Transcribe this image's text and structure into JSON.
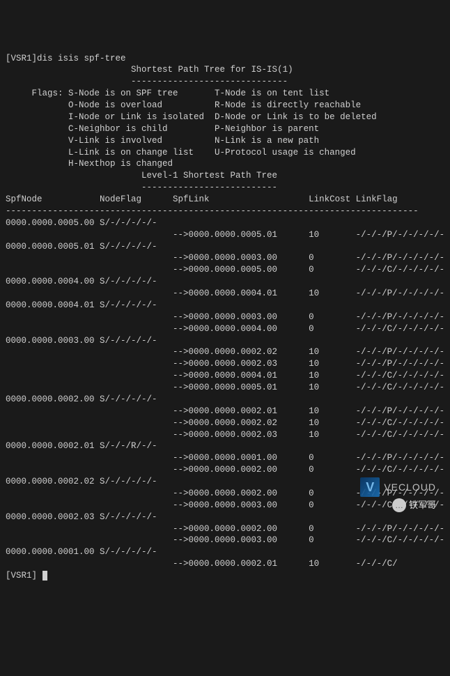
{
  "prompt1": "[VSR1]dis isis spf-tree",
  "title": "Shortest Path Tree for IS-IS(1)",
  "title_sep": "------------------------------",
  "flags_label": "Flags:",
  "flags": [
    {
      "l": "S-Node is on SPF tree",
      "r": "T-Node is on tent list"
    },
    {
      "l": "O-Node is overload",
      "r": "R-Node is directly reachable"
    },
    {
      "l": "I-Node or Link is isolated",
      "r": "D-Node or Link is to be deleted"
    },
    {
      "l": "C-Neighbor is child",
      "r": "P-Neighbor is parent"
    },
    {
      "l": "V-Link is involved",
      "r": "N-Link is a new path"
    },
    {
      "l": "L-Link is on change list",
      "r": "U-Protocol usage is changed"
    },
    {
      "l": "H-Nexthop is changed",
      "r": ""
    }
  ],
  "section_title": "Level-1 Shortest Path Tree",
  "section_sep": "--------------------------",
  "cols": {
    "c1": "SpfNode",
    "c2": "NodeFlag",
    "c3": "SpfLink",
    "c4": "LinkCost",
    "c5": "LinkFlag"
  },
  "hr": "-------------------------------------------------------------------------------",
  "rows": [
    {
      "node": "0000.0000.0005.00",
      "flag": "S/-/-/-/-/-",
      "links": [
        {
          "to": "-->0000.0000.0005.01",
          "cost": "10",
          "lf": "-/-/-/P/-/-/-/-/-"
        }
      ]
    },
    {
      "node": "0000.0000.0005.01",
      "flag": "S/-/-/-/-/-",
      "links": [
        {
          "to": "-->0000.0000.0003.00",
          "cost": "0",
          "lf": "-/-/-/P/-/-/-/-/-"
        },
        {
          "to": "-->0000.0000.0005.00",
          "cost": "0",
          "lf": "-/-/-/C/-/-/-/-/-"
        }
      ]
    },
    {
      "node": "0000.0000.0004.00",
      "flag": "S/-/-/-/-/-",
      "links": [
        {
          "to": "-->0000.0000.0004.01",
          "cost": "10",
          "lf": "-/-/-/P/-/-/-/-/-"
        }
      ]
    },
    {
      "node": "0000.0000.0004.01",
      "flag": "S/-/-/-/-/-",
      "links": [
        {
          "to": "-->0000.0000.0003.00",
          "cost": "0",
          "lf": "-/-/-/P/-/-/-/-/-"
        },
        {
          "to": "-->0000.0000.0004.00",
          "cost": "0",
          "lf": "-/-/-/C/-/-/-/-/-"
        }
      ]
    },
    {
      "node": "0000.0000.0003.00",
      "flag": "S/-/-/-/-/-",
      "links": [
        {
          "to": "-->0000.0000.0002.02",
          "cost": "10",
          "lf": "-/-/-/P/-/-/-/-/-"
        },
        {
          "to": "-->0000.0000.0002.03",
          "cost": "10",
          "lf": "-/-/-/P/-/-/-/-/-"
        },
        {
          "to": "-->0000.0000.0004.01",
          "cost": "10",
          "lf": "-/-/-/C/-/-/-/-/-"
        },
        {
          "to": "-->0000.0000.0005.01",
          "cost": "10",
          "lf": "-/-/-/C/-/-/-/-/-"
        }
      ]
    },
    {
      "node": "0000.0000.0002.00",
      "flag": "S/-/-/-/-/-",
      "links": [
        {
          "to": "-->0000.0000.0002.01",
          "cost": "10",
          "lf": "-/-/-/P/-/-/-/-/-"
        },
        {
          "to": "-->0000.0000.0002.02",
          "cost": "10",
          "lf": "-/-/-/C/-/-/-/-/-"
        },
        {
          "to": "-->0000.0000.0002.03",
          "cost": "10",
          "lf": "-/-/-/C/-/-/-/-/-"
        }
      ]
    },
    {
      "node": "0000.0000.0002.01",
      "flag": "S/-/-/R/-/-",
      "links": [
        {
          "to": "-->0000.0000.0001.00",
          "cost": "0",
          "lf": "-/-/-/P/-/-/-/-/-"
        },
        {
          "to": "-->0000.0000.0002.00",
          "cost": "0",
          "lf": "-/-/-/C/-/-/-/-/-"
        }
      ]
    },
    {
      "node": "0000.0000.0002.02",
      "flag": "S/-/-/-/-/-",
      "links": [
        {
          "to": "-->0000.0000.0002.00",
          "cost": "0",
          "lf": "-/-/-/P/-/-/-/-/-"
        },
        {
          "to": "-->0000.0000.0003.00",
          "cost": "0",
          "lf": "-/-/-/C/-/-/-/-/-"
        }
      ]
    },
    {
      "node": "0000.0000.0002.03",
      "flag": "S/-/-/-/-/-",
      "links": [
        {
          "to": "-->0000.0000.0002.00",
          "cost": "0",
          "lf": "-/-/-/P/-/-/-/-/-"
        },
        {
          "to": "-->0000.0000.0003.00",
          "cost": "0",
          "lf": "-/-/-/C/-/-/-/-/-"
        }
      ]
    },
    {
      "node": "0000.0000.0001.00",
      "flag": "S/-/-/-/-/-",
      "links": [
        {
          "to": "-->0000.0000.0002.01",
          "cost": "10",
          "lf": "-/-/-/C/"
        }
      ]
    }
  ],
  "prompt2": "[VSR1]",
  "watermark_brand": "VECLOUD",
  "wechat_label": "铁军哥"
}
